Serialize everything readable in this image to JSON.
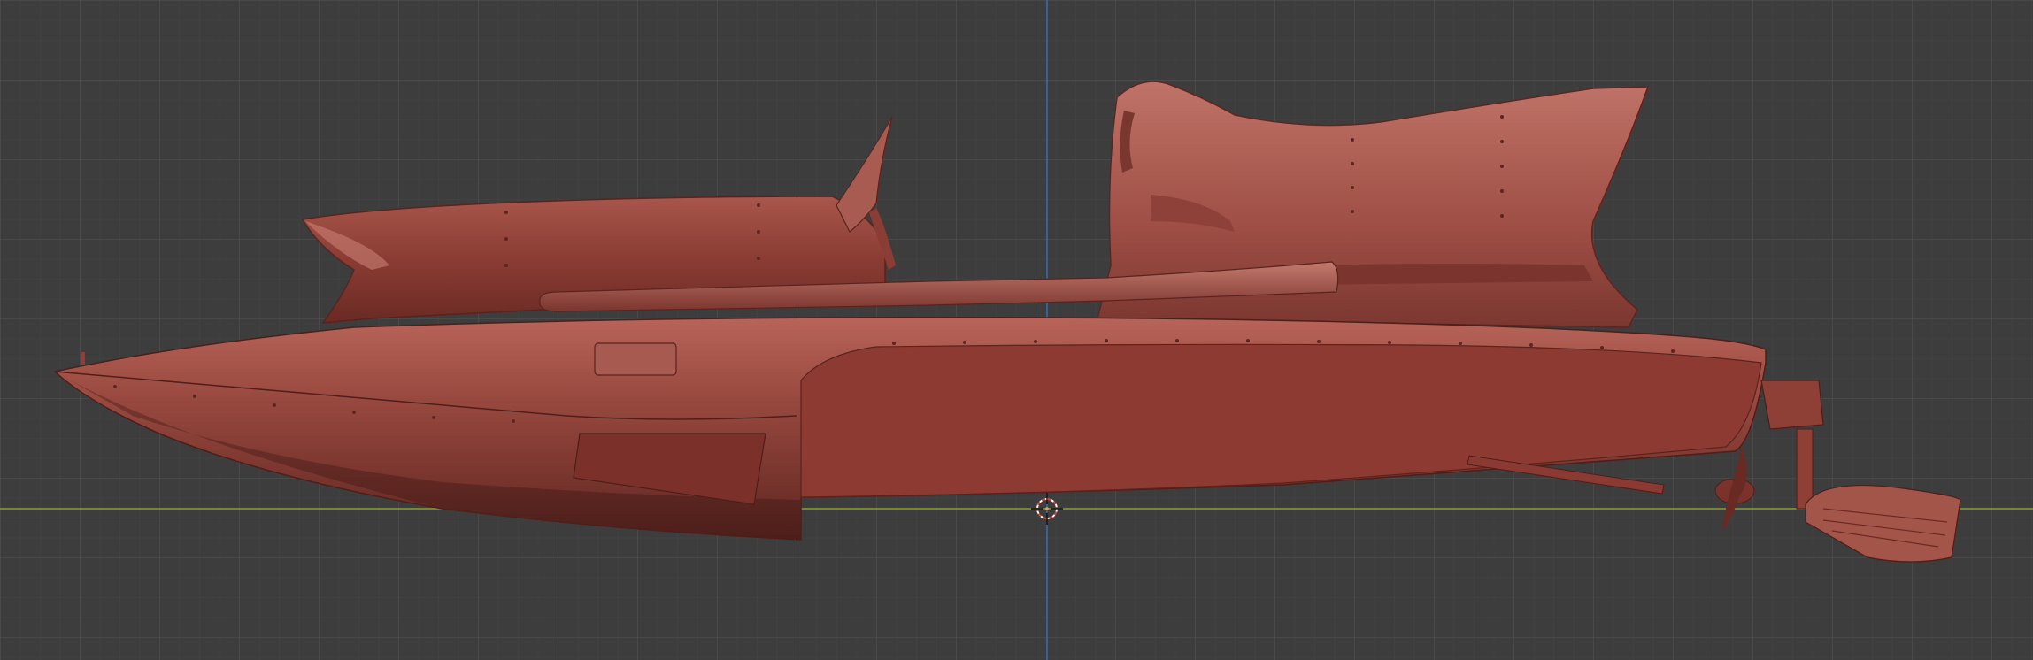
{
  "viewport": {
    "background_color": "#3d3d3d",
    "grid_color": "#505050",
    "x_axis_color": "#8aa02a",
    "z_axis_color": "#3b6bb5"
  },
  "model": {
    "name_icon": "speedboat-mesh",
    "material_color": "#9b4a40",
    "shade_color": "#6e2d27",
    "highlight_color": "#c27468"
  },
  "origin_icon": "3d-cursor-icon"
}
